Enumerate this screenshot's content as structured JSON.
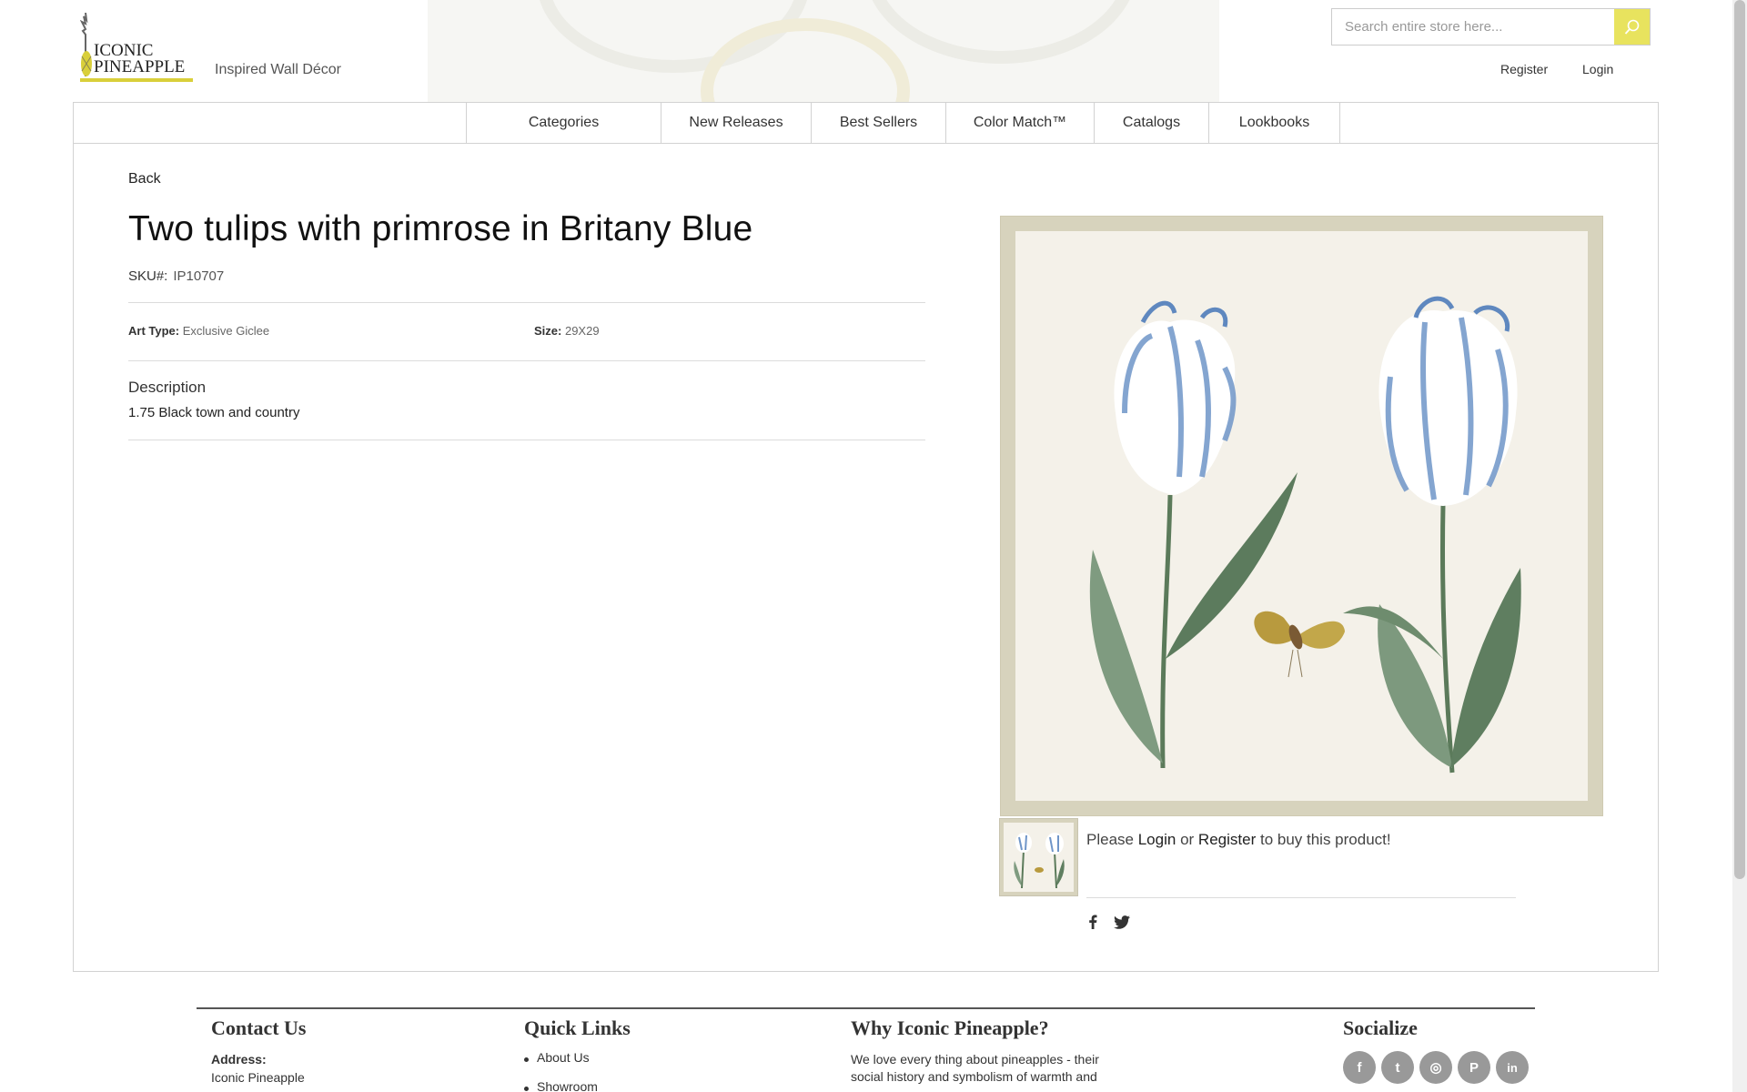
{
  "brand": {
    "logo_line1": "ICONIC",
    "logo_line2": "PINEAPPLE",
    "tagline": "Inspired Wall Décor",
    "accent": "#e8e35e"
  },
  "search": {
    "placeholder": "Search entire store here...",
    "value": ""
  },
  "auth": {
    "register": "Register",
    "login": "Login"
  },
  "nav": [
    {
      "label": "Categories"
    },
    {
      "label": "New Releases"
    },
    {
      "label": "Best Sellers"
    },
    {
      "label": "Color Match™"
    },
    {
      "label": "Catalogs"
    },
    {
      "label": "Lookbooks"
    }
  ],
  "product": {
    "back": "Back",
    "title": "Two tulips with primrose in Britany Blue",
    "sku_label": "SKU#:",
    "sku": "IP10707",
    "art_type_label": "Art Type:",
    "art_type": "Exclusive Giclee",
    "size_label": "Size:",
    "size": "29X29",
    "description_heading": "Description",
    "description": "1.75 Black town and country"
  },
  "buy": {
    "prefix": "Please",
    "login": "Login",
    "or": "or",
    "register": "Register",
    "suffix": "to buy this product!"
  },
  "share_icons": [
    "facebook-icon",
    "twitter-icon"
  ],
  "footer": {
    "contact_heading": "Contact Us",
    "address_label": "Address:",
    "address_line1": "Iconic Pineapple",
    "quick_links_heading": "Quick Links",
    "quick_links": [
      "About Us",
      "Showroom"
    ],
    "why_heading": "Why Iconic Pineapple?",
    "why_line1": "We love every thing about pineapples - their",
    "why_line2": "social history and symbolism of warmth and",
    "socialize_heading": "Socialize",
    "social": [
      {
        "icon": "facebook-icon",
        "glyph": "f"
      },
      {
        "icon": "twitter-icon",
        "glyph": "t"
      },
      {
        "icon": "instagram-icon",
        "glyph": "◎"
      },
      {
        "icon": "pinterest-icon",
        "glyph": "P"
      },
      {
        "icon": "linkedin-icon",
        "glyph": "in"
      }
    ]
  }
}
